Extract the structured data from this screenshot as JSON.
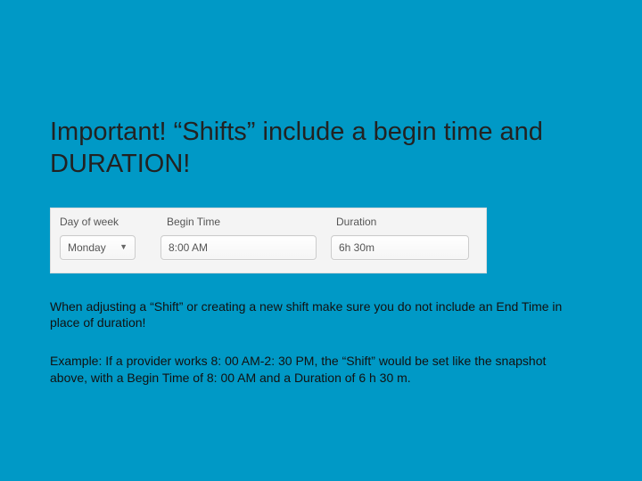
{
  "title": "Important! “Shifts” include a begin time and DURATION!",
  "form": {
    "headers": {
      "day": "Day of week",
      "begin": "Begin Time",
      "duration": "Duration"
    },
    "values": {
      "day": "Monday",
      "begin": "8:00 AM",
      "duration": "6h 30m"
    }
  },
  "paragraph1": "When adjusting a “Shift” or creating a new shift make sure you do not include an End Time in place of duration!",
  "paragraph2": "Example: If a provider works 8: 00 AM-2: 30 PM, the “Shift” would be set like the snapshot above, with a Begin Time of 8: 00 AM and a Duration of 6 h 30 m."
}
